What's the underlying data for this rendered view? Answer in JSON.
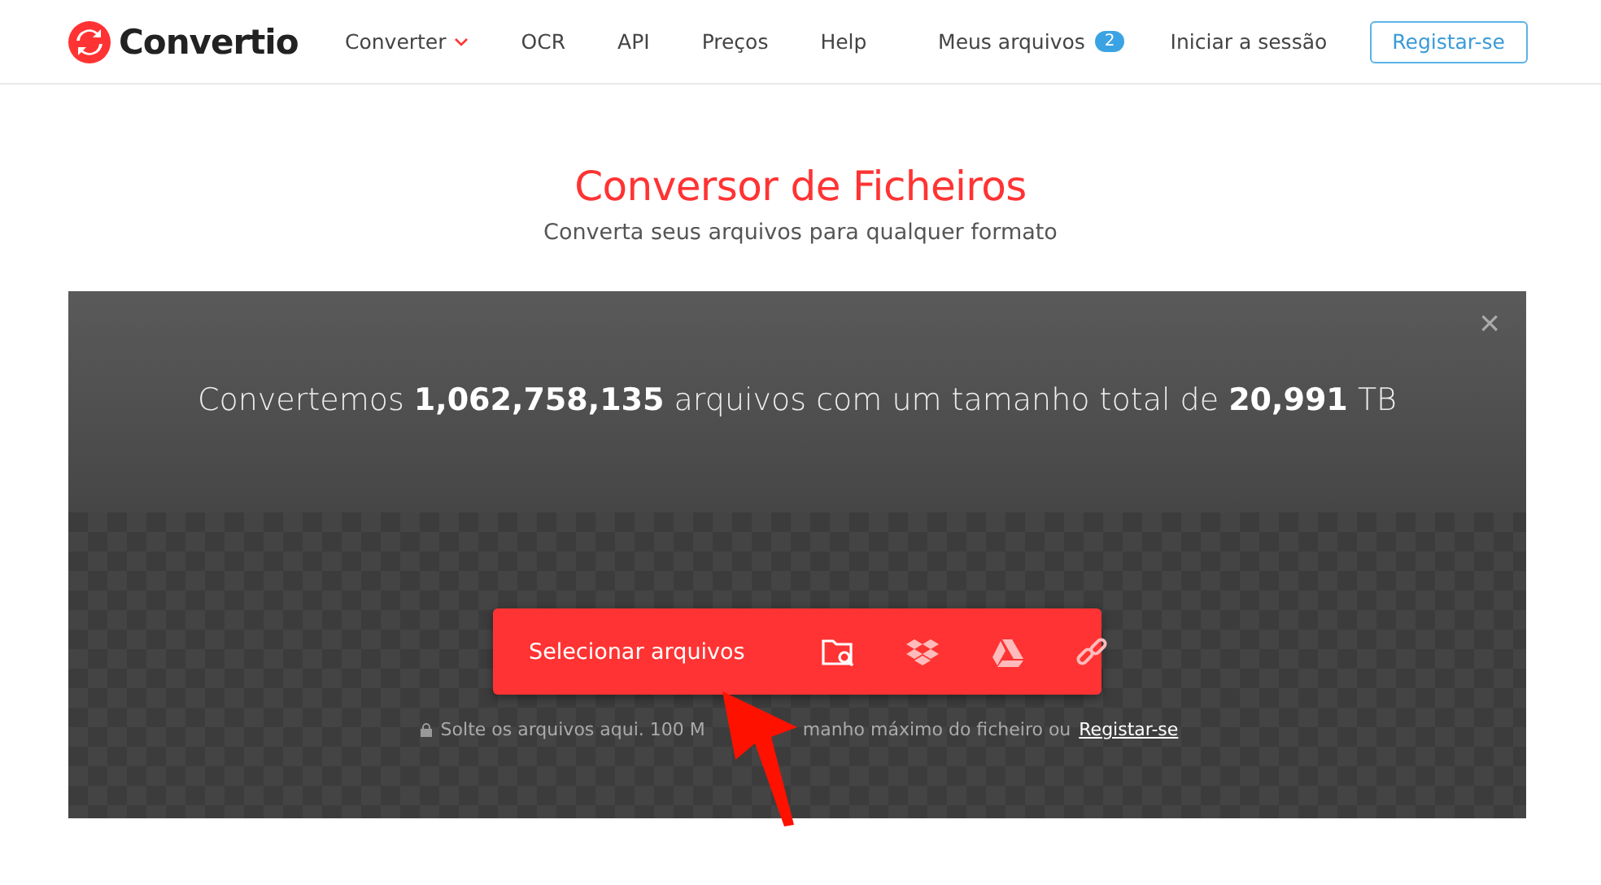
{
  "header": {
    "logo": "Convertio",
    "nav": [
      {
        "label": "Converter",
        "kind": "dropdown"
      },
      {
        "label": "OCR",
        "kind": "link"
      },
      {
        "label": "API",
        "kind": "link"
      },
      {
        "label": "Preços",
        "kind": "link"
      },
      {
        "label": "Help",
        "kind": "link"
      }
    ],
    "files_link": {
      "label": "Meus arquivos",
      "count": "2"
    },
    "login": "Iniciar a sessão",
    "register": "Registar-se"
  },
  "hero": {
    "title": "Conversor de Ficheiros",
    "subtitle": "Converta seus arquivos para qualquer formato"
  },
  "stats": {
    "text": "Convertemos **1,062,758,135** arquivos com um tamanho total de **20,991** TB",
    "close": "×"
  },
  "upload": {
    "button": "Selecionar arquivos",
    "sources": [
      {
        "kind": "folder"
      },
      {
        "kind": "dropbox"
      },
      {
        "kind": "drive"
      },
      {
        "kind": "link"
      }
    ],
    "hint_parts": [
      "Solte os arquivos aqui. 100 M",
      "manho máximo do ficheiro ou"
    ],
    "hint_link": "Registar-se"
  }
}
